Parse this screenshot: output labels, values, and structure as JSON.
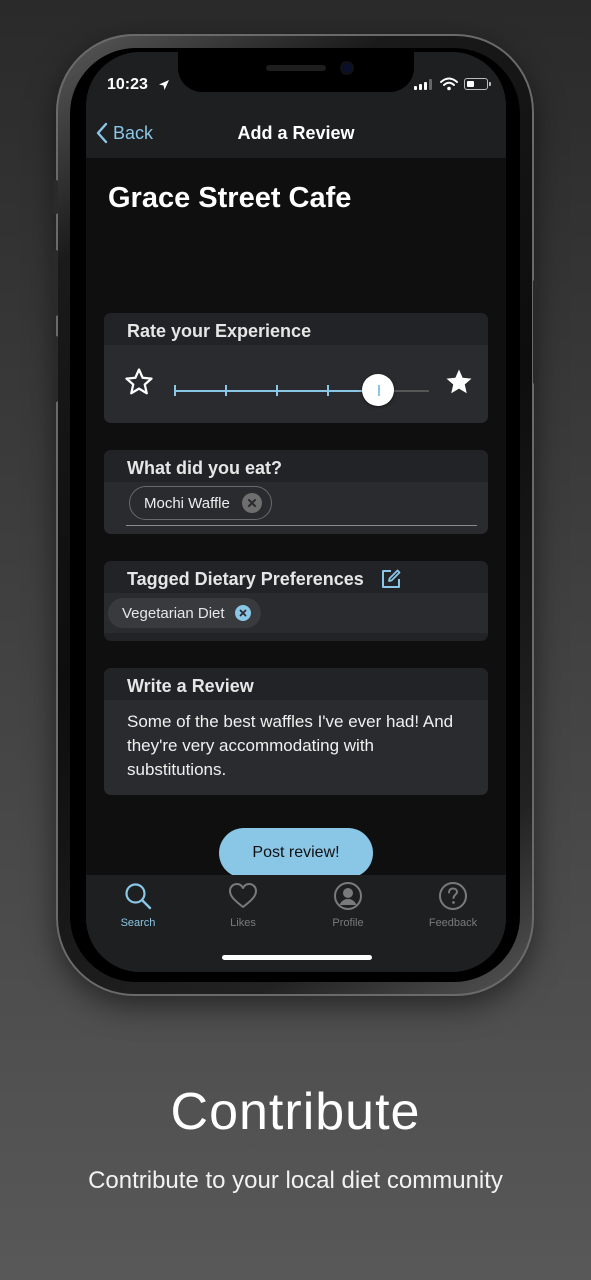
{
  "status_bar": {
    "time": "10:23"
  },
  "nav": {
    "back_label": "Back",
    "title": "Add a Review"
  },
  "restaurant": {
    "name": "Grace Street Cafe"
  },
  "rating": {
    "header": "Rate your Experience",
    "value": 4,
    "max": 5
  },
  "eat": {
    "header": "What did you eat?",
    "items": [
      "Mochi Waffle"
    ]
  },
  "diet": {
    "header": "Tagged Dietary Preferences",
    "tags": [
      "Vegetarian Diet"
    ]
  },
  "review": {
    "header": "Write a Review",
    "text": "Some of the best waffles I've ever had! And they're very accommodating with substitutions."
  },
  "post_button": "Post review!",
  "tabs": [
    {
      "label": "Search",
      "icon": "search-icon",
      "active": true
    },
    {
      "label": "Likes",
      "icon": "heart-icon",
      "active": false
    },
    {
      "label": "Profile",
      "icon": "profile-icon",
      "active": false
    },
    {
      "label": "Feedback",
      "icon": "help-icon",
      "active": false
    }
  ],
  "marketing": {
    "headline": "Contribute",
    "subheadline": "Contribute to your local diet community"
  },
  "colors": {
    "accent": "#8ac6e6",
    "surface": "#222326",
    "background": "#0f0f10"
  }
}
